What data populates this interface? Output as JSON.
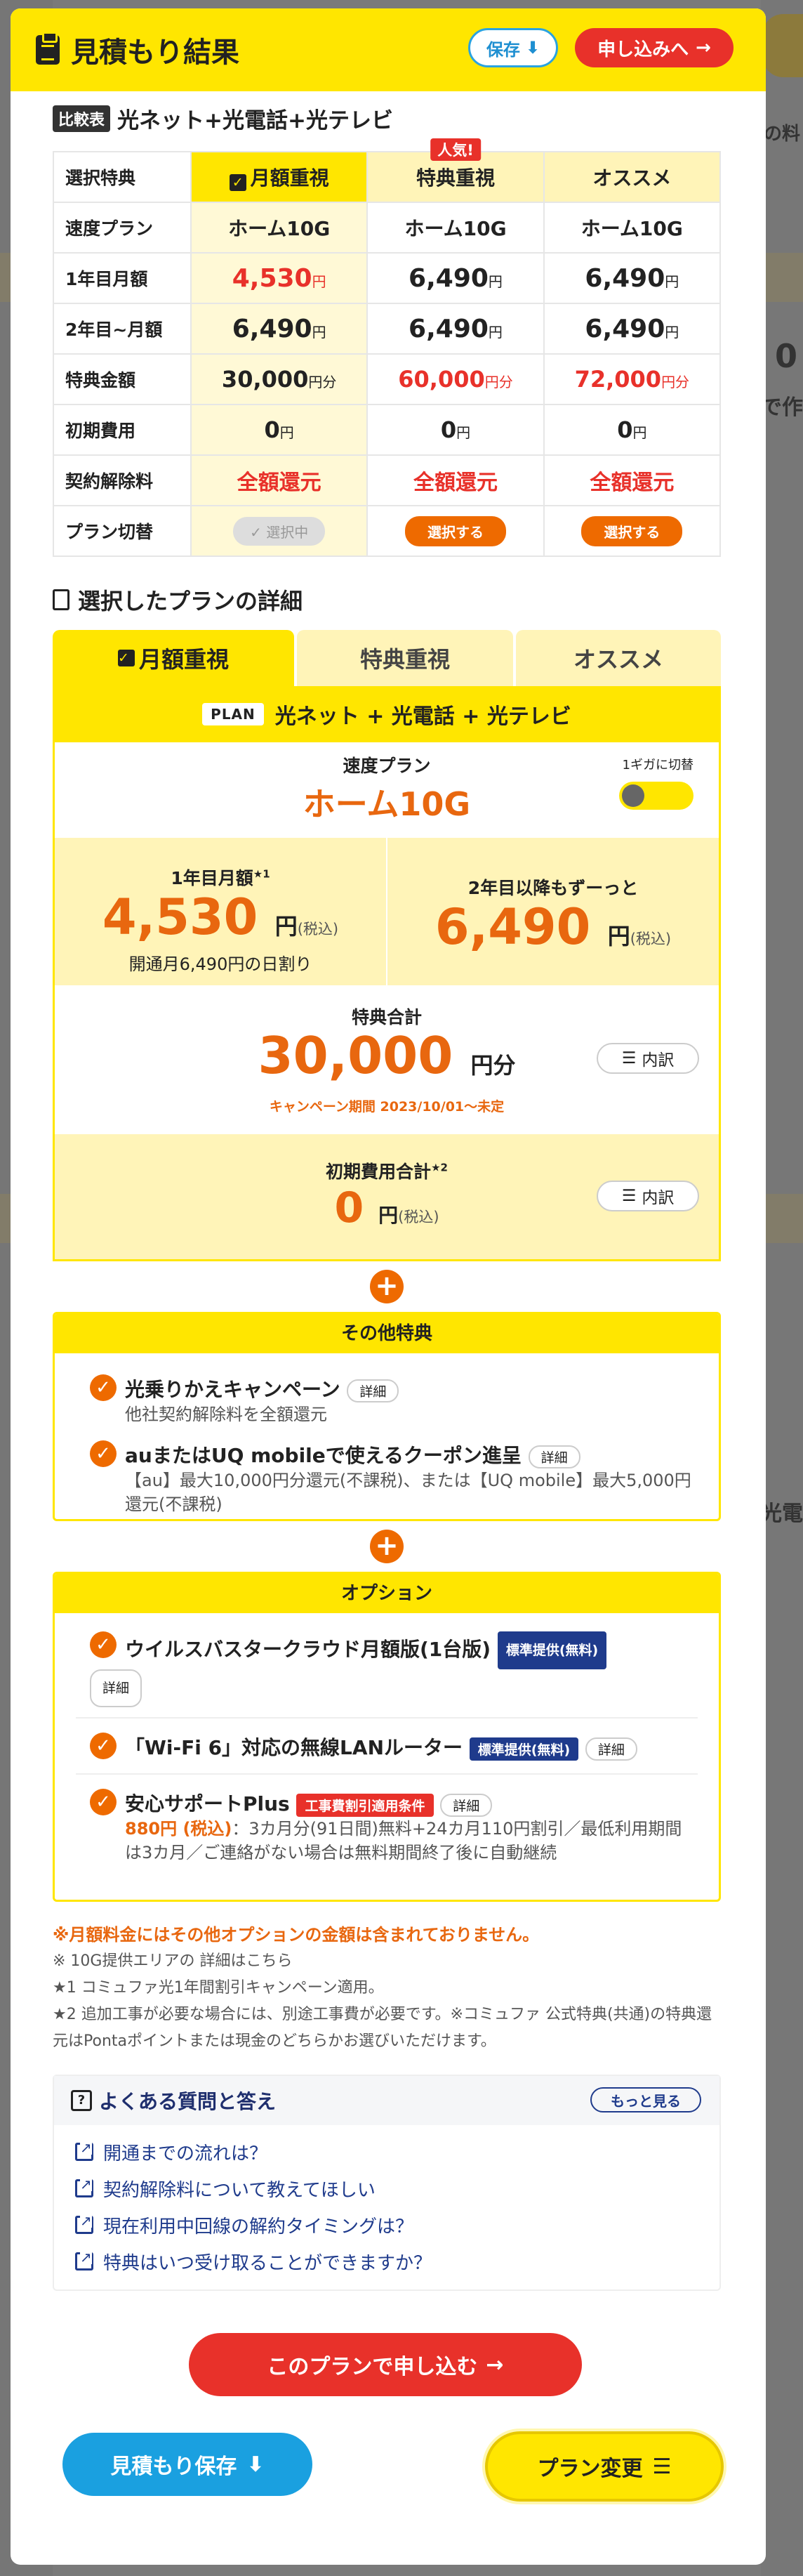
{
  "header": {
    "title": "見積もり結果",
    "save_label": "保存",
    "apply_label": "申し込みへ"
  },
  "background": {
    "text1": "の料",
    "text2": "0",
    "text3": "で作",
    "text4": "光電"
  },
  "comparison": {
    "badge": "比較表",
    "title": "光ネット+光電話+光テレビ",
    "popular_badge": "人気!",
    "columns": [
      "月額重視",
      "特典重視",
      "オススメ"
    ],
    "rows": [
      {
        "label": "選択特典"
      },
      {
        "label": "速度プラン",
        "values": [
          "ホーム10G",
          "ホーム10G",
          "ホーム10G"
        ]
      },
      {
        "label": "1年目月額",
        "values": [
          "4,530",
          "6,490",
          "6,490"
        ],
        "unit": "円"
      },
      {
        "label": "2年目~月額",
        "values": [
          "6,490",
          "6,490",
          "6,490"
        ],
        "unit": "円"
      },
      {
        "label": "特典金額",
        "values": [
          "30,000",
          "60,000",
          "72,000"
        ],
        "unit": "円分"
      },
      {
        "label": "初期費用",
        "values": [
          "0",
          "0",
          "0"
        ],
        "unit": "円"
      },
      {
        "label": "契約解除料",
        "values": [
          "全額還元",
          "全額還元",
          "全額還元"
        ]
      },
      {
        "label": "プラン切替",
        "values": [
          "選択中",
          "選択する",
          "選択する"
        ]
      }
    ]
  },
  "detail": {
    "title": "選択したプランの詳細",
    "tabs": [
      "月額重視",
      "特典重視",
      "オススメ"
    ],
    "plan_badge": "PLAN",
    "plan_name": "光ネット + 光電話 + 光テレビ",
    "speed_label": "速度プラン",
    "speed_value": "ホーム10G",
    "giga_label": "1ギガに切替",
    "first_year_label": "1年目月額",
    "first_year_note_mark": "★1",
    "first_year_value": "4,530",
    "yen": "円",
    "tax": "(税込)",
    "first_year_note": "開通月6,490円の日割り",
    "second_year_label": "2年目以降もずーっと",
    "second_year_value": "6,490",
    "total_label": "特典合計",
    "total_value": "30,000",
    "total_unit": "円分",
    "campaign": "キャンペーン期間 2023/10/01～未定",
    "breakdown": "内訳",
    "initial_label": "初期費用合計",
    "initial_mark": "★2",
    "initial_value": "0"
  },
  "other_benefits": {
    "title": "その他特典",
    "items": [
      {
        "title": "光乗りかえキャンペーン",
        "tag": "詳細",
        "desc": "他社契約解除料を全額還元"
      },
      {
        "title": "auまたはUQ mobileで使えるクーポン進呈",
        "tag": "詳細",
        "desc": "【au】最大10,000円分還元(不課税)、または【UQ mobile】最大5,000円還元(不課税)"
      }
    ]
  },
  "options": {
    "title": "オプション",
    "items": [
      {
        "title": "ウイルスバスタークラウド月額版(1台版)",
        "badge": "標準提供(無料)",
        "tag": "詳細"
      },
      {
        "title": "「Wi-Fi 6」対応の無線LANルーター",
        "badge": "標準提供(無料)",
        "tag": "詳細"
      },
      {
        "title": "安心サポートPlus",
        "badge": "工事費割引適用条件",
        "tag": "詳細",
        "price": "880円 (税込)",
        "desc": "：3カ月分(91日間)無料+24カ月110円割引／最低利用期間は3カ月／ご連絡がない場合は無料期間終了後に自動継続"
      }
    ]
  },
  "notes": {
    "warning": "※月額料金にはその他オプションの金額は含まれておりません。",
    "line1": "※ 10G提供エリアの 詳細はこちら",
    "line2": "★1 コミュファ光1年間割引キャンペーン適用。",
    "line3": "★2 追加工事が必要な場合には、別途工事費が必要です。※コミュファ 公式特典(共通)の特典還元はPontaポイントまたは現金のどちらかお選びいただけます。"
  },
  "faq": {
    "title": "よくある質問と答え",
    "more": "もっと見る",
    "items": [
      "開通までの流れは？",
      "契約解除料について教えてほしい",
      "現在利用中回線の解約タイミングは？",
      "特典はいつ受け取ることができますか？"
    ]
  },
  "footer": {
    "apply_label": "このプランで申し込む",
    "save_label": "見積もり保存",
    "change_label": "プラン変更"
  }
}
